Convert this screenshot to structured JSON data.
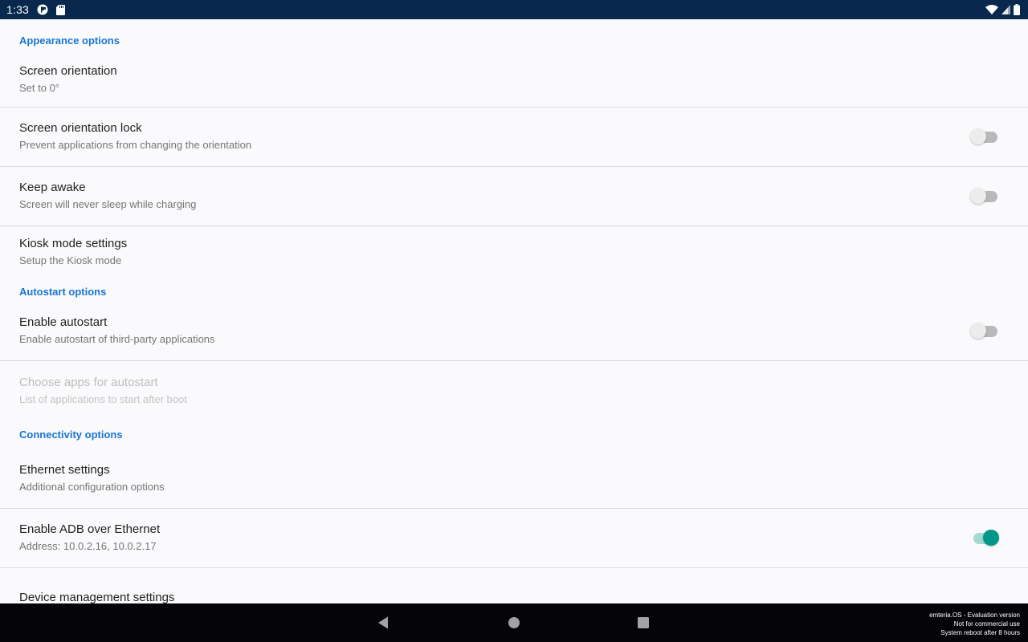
{
  "status_bar": {
    "time": "1:33",
    "left_icons": [
      "app-notification-icon",
      "sd-card-icon"
    ],
    "right_icons": [
      "wifi-icon",
      "cell-signal-icon",
      "battery-icon"
    ]
  },
  "sections": [
    {
      "category": "Appearance options",
      "items": [
        {
          "title": "Screen orientation",
          "summary": "Set to 0°",
          "widget": null
        },
        {
          "title": "Screen orientation lock",
          "summary": "Prevent applications from changing the orientation",
          "widget": "switch",
          "checked": false
        },
        {
          "title": "Keep awake",
          "summary": "Screen will never sleep while charging",
          "widget": "switch",
          "checked": false
        },
        {
          "title": "Kiosk mode settings",
          "summary": "Setup the Kiosk mode",
          "widget": null
        }
      ]
    },
    {
      "category": "Autostart options",
      "items": [
        {
          "title": "Enable autostart",
          "summary": "Enable autostart of third-party applications",
          "widget": "switch",
          "checked": false
        },
        {
          "title": "Choose apps for autostart",
          "summary": "List of applications to start after boot",
          "widget": null,
          "enabled": false
        }
      ]
    },
    {
      "category": "Connectivity options",
      "items": [
        {
          "title": "Ethernet settings",
          "summary": "Additional configuration options",
          "widget": null
        },
        {
          "title": "Enable ADB over Ethernet",
          "summary": "Address: 10.0.2.16, 10.0.2.17",
          "widget": "switch",
          "checked": true
        },
        {
          "title": "Device management settings",
          "summary": "",
          "widget": null
        }
      ]
    }
  ],
  "nav_bar": {
    "buttons": [
      "back",
      "home",
      "recents"
    ],
    "watermark": [
      "emteria.OS - Evaluation version",
      "Not for commercial use",
      "System reboot after 8 hours"
    ]
  },
  "colors": {
    "status_bar": "#08294d",
    "category": "#1976d2",
    "switch_on": "#009688",
    "nav_bar": "#050508"
  }
}
